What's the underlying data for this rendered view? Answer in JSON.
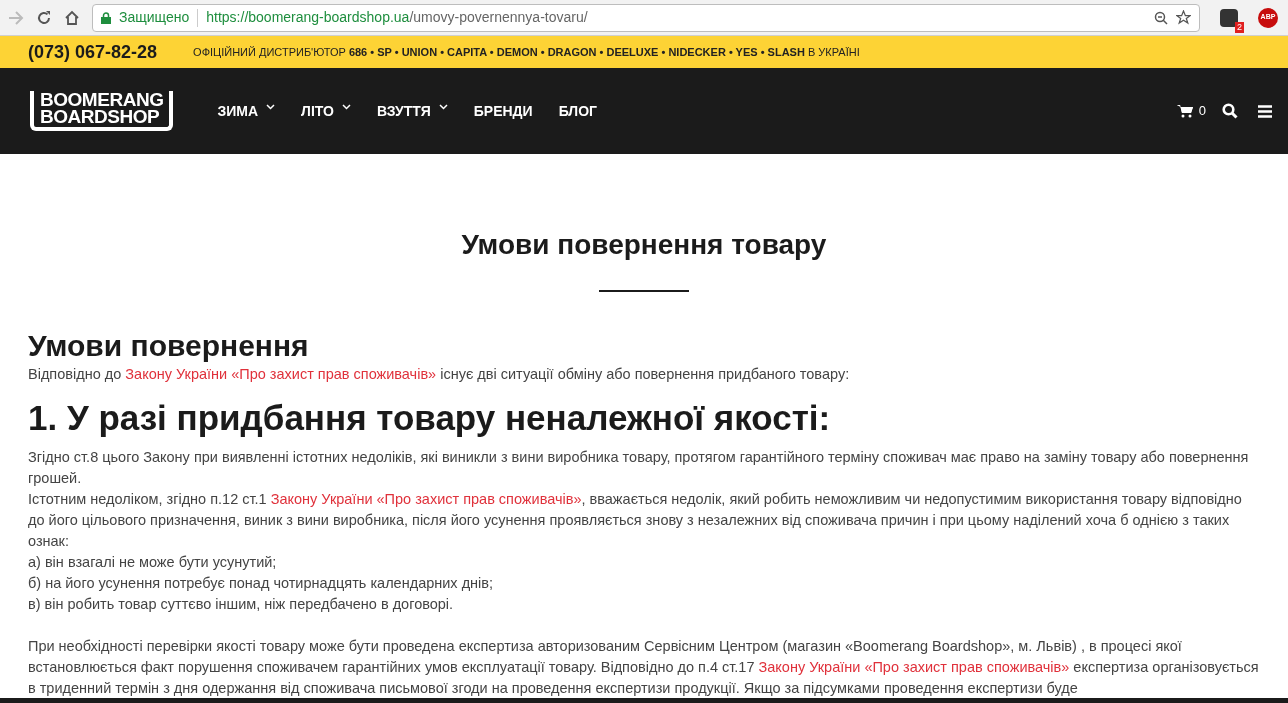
{
  "browser": {
    "security_label": "Защищено",
    "url_host": "https://boomerang-boardshop.ua",
    "url_path": "/umovy-povernennya-tovaru/",
    "extension_badge": "2",
    "abp_label": "ABP"
  },
  "topbar": {
    "phone": "(073) 067-82-28",
    "distributor_prefix": "ОФІЦІЙНИЙ ДИСТРИБ'ЮТОР",
    "brands": "686 • SP • UNION • CAPITA • DEMON • DRAGON • DEELUXE • NIDECKER • YES • SLASH",
    "distributor_suffix": "В УКРАЇНІ"
  },
  "nav": {
    "logo_lines": [
      "BOOMERANG",
      "BOARDSHOP"
    ],
    "items": [
      {
        "label": "ЗИМА",
        "has_dropdown": true
      },
      {
        "label": "ЛІТО",
        "has_dropdown": true
      },
      {
        "label": "ВЗУТТЯ",
        "has_dropdown": true
      },
      {
        "label": "БРЕНДИ",
        "has_dropdown": false
      },
      {
        "label": "БЛОГ",
        "has_dropdown": false
      }
    ],
    "cart_count": "0"
  },
  "page_title": "Умови повернення товару",
  "content": [
    {
      "kind": "h2",
      "text": "Умови повернення"
    },
    {
      "kind": "p",
      "segments": [
        {
          "text": "Відповідно до "
        },
        {
          "link": "Закону України «Про захист прав споживачів»"
        },
        {
          "text": " існує дві ситуації обміну або повернення придбаного товару:"
        }
      ]
    },
    {
      "kind": "h1",
      "text": "1. У разі придбання товару неналежної якості:"
    },
    {
      "kind": "p",
      "segments": [
        {
          "text": "Згідно ст.8 цього Закону при виявленні істотних недоліків, які виникли з вини виробника товару, протягом гарантійного терміну споживач має право на заміну товару або повернення грошей."
        }
      ]
    },
    {
      "kind": "p",
      "segments": [
        {
          "text": "Істотним недоліком, згідно п.12 ст.1 "
        },
        {
          "link": "Закону України «Про захист прав споживачів»"
        },
        {
          "text": ", вважається недолік, який робить неможливим чи недопустимим використання товару відповідно до його цільового призначення, виник з вини виробника, після його усунення проявляється знову з незалежних від споживача причин і при цьому наділений хоча б однією з таких ознак:"
        }
      ]
    },
    {
      "kind": "p",
      "segments": [
        {
          "text": "а) він взагалі не може бути усунутий;"
        }
      ]
    },
    {
      "kind": "p",
      "segments": [
        {
          "text": "б) на його усунення потребує понад чотирнадцять календарних днів;"
        }
      ]
    },
    {
      "kind": "p",
      "segments": [
        {
          "text": "в) він робить товар суттєво іншим, ніж передбачено в договорі."
        }
      ]
    },
    {
      "kind": "gap"
    },
    {
      "kind": "p",
      "segments": [
        {
          "text": "При необхідності перевірки якості товару може бути проведена експертиза авторизованим Сервісним Центром (магазин «Boomerang Boardshop», м. Львів) , в процесі якої встановлюється факт порушення споживачем гарантійних умов експлуатації товару. Відповідно до п.4 ст.17 "
        },
        {
          "link": "Закону України «Про захист прав споживачів»"
        },
        {
          "text": " експертиза організовується в триденний термін з дня одержання від споживача письмової згоди на проведення експертизи продукції. Якщо за підсумками проведення експертизи буде"
        }
      ]
    }
  ]
}
